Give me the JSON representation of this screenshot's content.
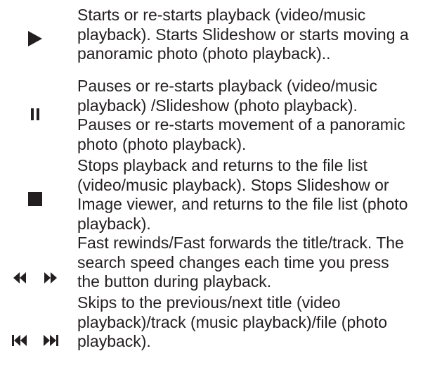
{
  "rows": [
    {
      "icon": "play-icon",
      "text": "Starts or re-starts playback (video/music playback). Starts Slideshow or starts moving a panoramic photo (photo playback).."
    },
    {
      "icon": "pause-icon",
      "text": "Pauses or re-starts playback (video/music playback) /Slideshow (photo playback). Pauses or re-starts movement of a panoramic photo (photo playback)."
    },
    {
      "icon": "stop-icon",
      "text": "Stops playback and returns to the file list (video/music playback). Stops Slideshow or Image viewer, and returns to the file list (photo playback)."
    },
    {
      "icon": "rewind-fast-forward-icon",
      "text": "Fast rewinds/Fast forwards the title/track. The search speed changes each time you press the button during playback."
    },
    {
      "icon": "skip-previous-next-icon",
      "text": "Skips to the previous/next title (video playback)/track (music playback)/file (photo playback)."
    }
  ]
}
